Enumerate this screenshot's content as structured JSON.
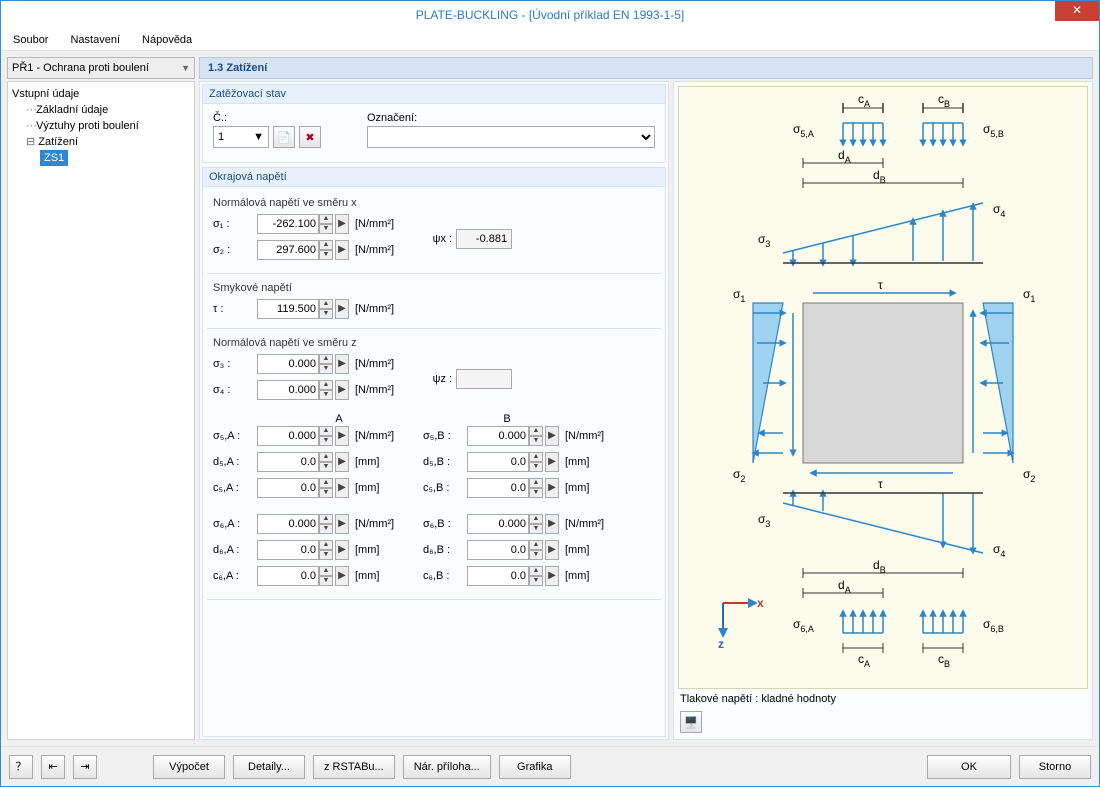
{
  "window": {
    "title": "PLATE-BUCKLING - [Úvodní příklad EN 1993-1-5]"
  },
  "menu": {
    "file": "Soubor",
    "settings": "Nastavení",
    "help": "Nápověda"
  },
  "leftcombo": {
    "value": "PŘ1 - Ochrana proti boulení"
  },
  "tree": {
    "root": "Vstupní údaje",
    "n1": "Základní údaje",
    "n2": "Výztuhy proti boulení",
    "n3": "Zatížení",
    "leaf": "ZS1"
  },
  "panel": {
    "title": "1.3 Zatížení"
  },
  "loadcase": {
    "group": "Zatěžovací stav",
    "num_label": "Č.:",
    "num_value": "1",
    "desc_label": "Označení:",
    "desc_value": ""
  },
  "edge": {
    "group": "Okrajová napětí",
    "nx_title": "Normálová napětí ve směru x",
    "sigma1_l": "σ₁ :",
    "sigma1_v": "-262.100",
    "u_nmm2": "[N/mm²]",
    "sigma2_l": "σ₂ :",
    "sigma2_v": "297.600",
    "psix_l": "ψx :",
    "psix_v": "-0.881",
    "shear_title": "Smykové napětí",
    "tau_l": "τ :",
    "tau_v": "119.500",
    "nz_title": "Normálová napětí ve směru z",
    "sigma3_l": "σ₃ :",
    "sigma3_v": "0.000",
    "sigma4_l": "σ₄ :",
    "sigma4_v": "0.000",
    "psiz_l": "ψz :",
    "psiz_v": "",
    "colA": "A",
    "colB": "B",
    "u_mm": "[mm]",
    "s5A_l": "σ₅,A :",
    "s5A_v": "0.000",
    "d5A_l": "d₅,A :",
    "d5A_v": "0.0",
    "c5A_l": "c₅,A :",
    "c5A_v": "0.0",
    "s5B_l": "σ₅,B :",
    "s5B_v": "0.000",
    "d5B_l": "d₅,B :",
    "d5B_v": "0.0",
    "c5B_l": "c₅,B :",
    "c5B_v": "0.0",
    "s6A_l": "σ₆,A :",
    "s6A_v": "0.000",
    "d6A_l": "d₆,A :",
    "d6A_v": "0.0",
    "c6A_l": "c₆,A :",
    "c6A_v": "0.0",
    "s6B_l": "σ₆,B :",
    "s6B_v": "0.000",
    "d6B_l": "d₆,B :",
    "d6B_v": "0.0",
    "c6B_l": "c₆,B :",
    "c6B_v": "0.0"
  },
  "diagram": {
    "caption": "Tlakové napětí : kladné hodnoty",
    "labels": {
      "cA": "c",
      "cAsub": "A",
      "cB": "c",
      "cBsub": "B",
      "s5A": "σ",
      "s5Asub": "5,A",
      "s5B": "σ",
      "s5Bsub": "5,B",
      "dA": "d",
      "dAsub": "A",
      "dB": "d",
      "dBsub": "B",
      "s3": "σ",
      "s3sub": "3",
      "s4": "σ",
      "s4sub": "4",
      "s1": "σ",
      "s1sub": "1",
      "s2": "σ",
      "s2sub": "2",
      "tau": "τ",
      "s6A": "σ",
      "s6Asub": "6,A",
      "s6B": "σ",
      "s6Bsub": "6,B",
      "x": "x",
      "z": "z"
    }
  },
  "footer": {
    "calc": "Výpočet",
    "details": "Detaily...",
    "rstab": "z RSTABu...",
    "annex": "Nár. příloha...",
    "graphic": "Grafika",
    "ok": "OK",
    "cancel": "Storno"
  }
}
